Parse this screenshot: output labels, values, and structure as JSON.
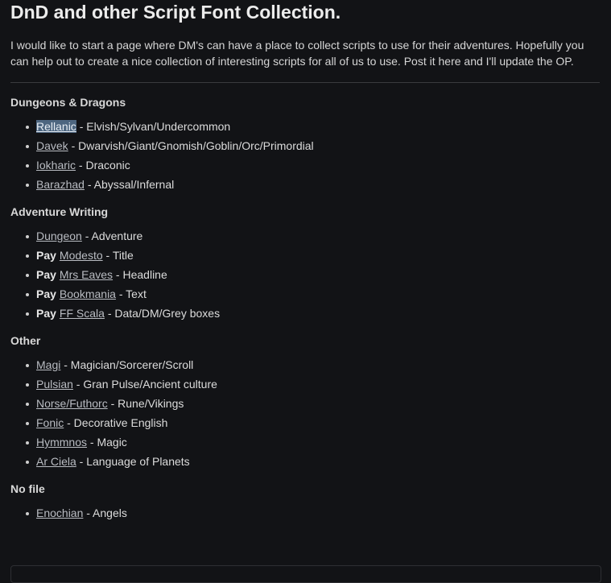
{
  "title": "DnD and other Script Font Collection.",
  "intro": "I would like to start a page where DM's can have a place to collect scripts to use for their adventures. Hopefully you can help out to create a nice collection of interesting scripts for all of us to use. Post it here and I'll update the OP.",
  "sections": [
    {
      "heading": "Dungeons & Dragons",
      "items": [
        {
          "link": "Rellanic",
          "desc": " - Elvish/Sylvan/Undercommon",
          "selected": true
        },
        {
          "link": "Davek",
          "desc": " - Dwarvish/Giant/Gnomish/Goblin/Orc/Primordial"
        },
        {
          "link": "Iokharic",
          "desc": " - Draconic"
        },
        {
          "link": "Barazhad",
          "desc": " - Abyssal/Infernal"
        }
      ]
    },
    {
      "heading": "Adventure Writing",
      "items": [
        {
          "link": "Dungeon",
          "desc": " - Adventure"
        },
        {
          "prefix": "Pay",
          "link": "Modesto",
          "desc": " - Title"
        },
        {
          "prefix": "Pay",
          "link": "Mrs Eaves",
          "desc": " - Headline"
        },
        {
          "prefix": "Pay",
          "link": "Bookmania",
          "desc": " - Text"
        },
        {
          "prefix": "Pay",
          "link": "FF Scala",
          "desc": " - Data/DM/Grey boxes"
        }
      ]
    },
    {
      "heading": "Other",
      "items": [
        {
          "link": "Magi",
          "desc": " - Magician/Sorcerer/Scroll"
        },
        {
          "link": "Pulsian",
          "desc": " - Gran Pulse/Ancient culture"
        },
        {
          "link": "Norse/Futhorc",
          "desc": " - Rune/Vikings"
        },
        {
          "link": "Fonic",
          "desc": " - Decorative English"
        },
        {
          "link": "Hymmnos",
          "desc": " - Magic"
        },
        {
          "link": "Ar Ciela",
          "desc": " - Language of Planets"
        }
      ]
    },
    {
      "heading": "No file",
      "items": [
        {
          "link": "Enochian",
          "desc": " - Angels"
        }
      ]
    }
  ]
}
